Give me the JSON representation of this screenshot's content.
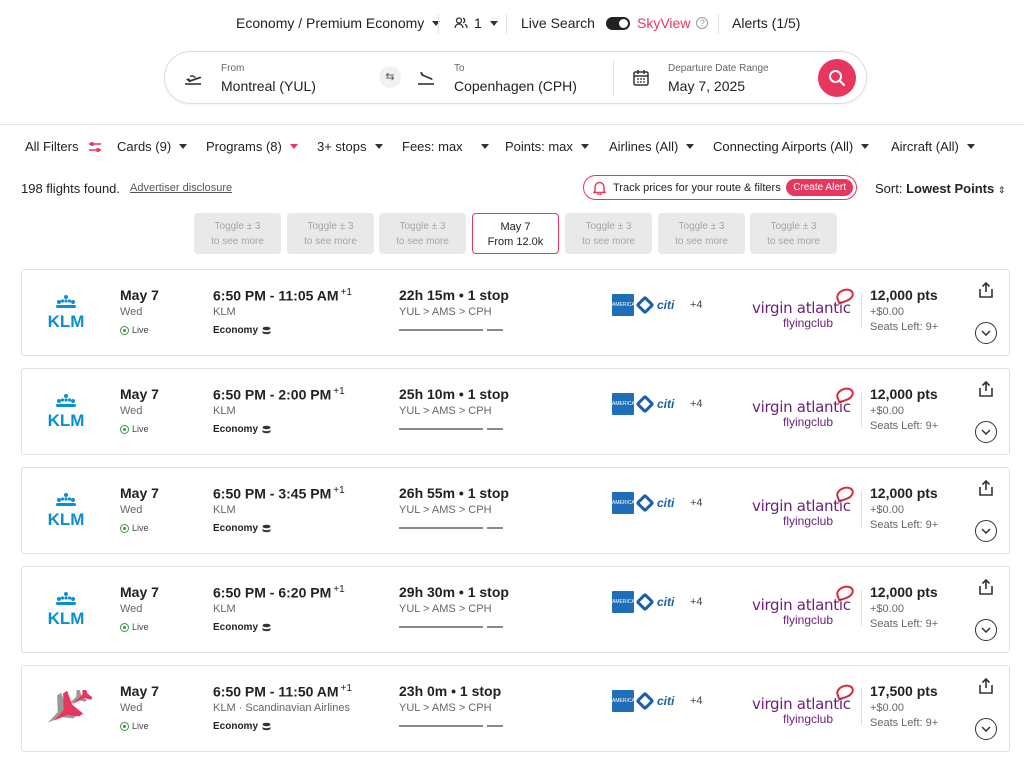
{
  "topbar": {
    "cabin": "Economy / Premium Economy",
    "passengers": "1",
    "live_search": "Live Search",
    "skyview": "SkyView",
    "alerts": "Alerts (1/5)"
  },
  "search": {
    "from_label": "From",
    "from_value": "Montreal (YUL)",
    "to_label": "To",
    "to_value": "Copenhagen (CPH)",
    "date_label": "Departure Date Range",
    "date_value": "May 7, 2025"
  },
  "filters": {
    "all": "All Filters",
    "cards": "Cards (9)",
    "programs": "Programs (8)",
    "stops": "3+ stops",
    "fees": "Fees: max",
    "points": "Points: max",
    "airlines": "Airlines (All)",
    "connecting": "Connecting Airports (All)",
    "aircraft": "Aircraft (All)"
  },
  "results": {
    "count": "198 flights found.",
    "disclosure": "Advertiser disclosure",
    "alert_text": "Track prices for your route & filters",
    "alert_button": "Create Alert",
    "sort_label": "Sort:",
    "sort_value": "Lowest Points"
  },
  "date_chips": [
    {
      "line1": "Toggle ± 3",
      "line2": "to see more"
    },
    {
      "line1": "Toggle ± 3",
      "line2": "to see more"
    },
    {
      "line1": "Toggle ± 3",
      "line2": "to see more"
    },
    {
      "line1": "May 7",
      "line2": "From 12.0k"
    },
    {
      "line1": "Toggle ± 3",
      "line2": "to see more"
    },
    {
      "line1": "Toggle ± 3",
      "line2": "to see more"
    },
    {
      "line1": "Toggle ± 3",
      "line2": "to see more"
    }
  ],
  "flights": [
    {
      "date": "May 7",
      "dow": "Wed",
      "live": "Live",
      "times": "6:50 PM - 11:05 AM",
      "plus_day": "+1",
      "airline": "KLM",
      "cabin": "Economy",
      "duration": "22h 15m • 1 stop",
      "route": "YUL  >  AMS  >  CPH",
      "cards_more": "+4",
      "program_top": "virgin atlantic",
      "program_bottom": "flyingclub",
      "points": "12,000 pts",
      "fees": "+$0.00",
      "seats": "Seats Left: 9+",
      "logo": "klm-logo"
    },
    {
      "date": "May 7",
      "dow": "Wed",
      "live": "Live",
      "times": "6:50 PM - 2:00 PM",
      "plus_day": "+1",
      "airline": "KLM",
      "cabin": "Economy",
      "duration": "25h 10m • 1 stop",
      "route": "YUL  >  AMS  >  CPH",
      "cards_more": "+4",
      "program_top": "virgin atlantic",
      "program_bottom": "flyingclub",
      "points": "12,000 pts",
      "fees": "+$0.00",
      "seats": "Seats Left: 9+",
      "logo": "klm-logo"
    },
    {
      "date": "May 7",
      "dow": "Wed",
      "live": "Live",
      "times": "6:50 PM - 3:45 PM",
      "plus_day": "+1",
      "airline": "KLM",
      "cabin": "Economy",
      "duration": "26h 55m • 1 stop",
      "route": "YUL  >  AMS  >  CPH",
      "cards_more": "+4",
      "program_top": "virgin atlantic",
      "program_bottom": "flyingclub",
      "points": "12,000 pts",
      "fees": "+$0.00",
      "seats": "Seats Left: 9+",
      "logo": "klm-logo"
    },
    {
      "date": "May 7",
      "dow": "Wed",
      "live": "Live",
      "times": "6:50 PM - 6:20 PM",
      "plus_day": "+1",
      "airline": "KLM",
      "cabin": "Economy",
      "duration": "29h 30m • 1 stop",
      "route": "YUL  >  AMS  >  CPH",
      "cards_more": "+4",
      "program_top": "virgin atlantic",
      "program_bottom": "flyingclub",
      "points": "12,000 pts",
      "fees": "+$0.00",
      "seats": "Seats Left: 9+",
      "logo": "klm-logo"
    },
    {
      "date": "May 7",
      "dow": "Wed",
      "live": "Live",
      "times": "6:50 PM - 11:50 AM",
      "plus_day": "+1",
      "airline": "KLM · Scandinavian Airlines",
      "cabin": "Economy",
      "duration": "23h 0m • 1 stop",
      "route": "YUL  >  AMS  >  CPH",
      "cards_more": "+4",
      "program_top": "virgin atlantic",
      "program_bottom": "flyingclub",
      "points": "17,500 pts",
      "fees": "+$0.00",
      "seats": "Seats Left: 9+",
      "logo": "plane-icon"
    }
  ],
  "logos": {
    "klm_text": "KLM",
    "amex_text": "AMERICAN EXPRESS"
  },
  "colors": {
    "accent": "#e8375f",
    "klm_blue": "#0a8fd3",
    "virgin_purple": "#6a1f7a"
  }
}
